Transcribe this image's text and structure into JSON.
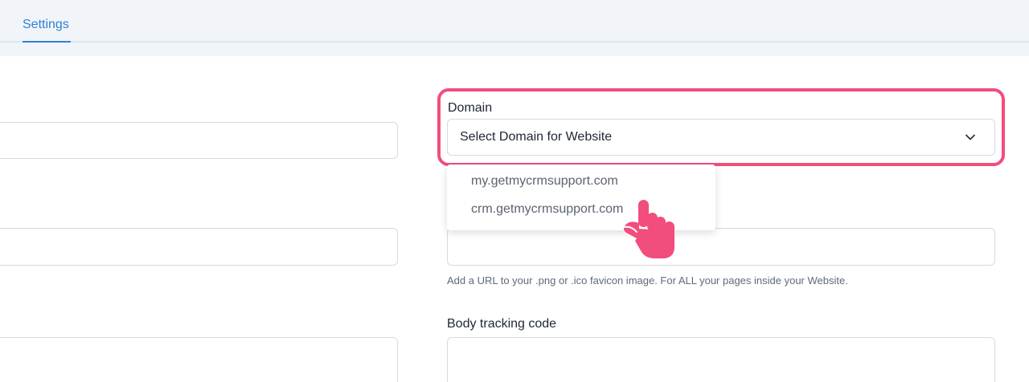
{
  "tabs": {
    "settings_label": "Settings"
  },
  "domain_field": {
    "label": "Domain",
    "selected_value": "Select Domain for Website",
    "options": [
      "my.getmycrmsupport.com",
      "crm.getmycrmsupport.com"
    ]
  },
  "favicon_field": {
    "help_text": "Add a URL to your .png or .ico favicon image. For ALL your pages inside your Website."
  },
  "body_tracking_field": {
    "label": "Body tracking code"
  },
  "colors": {
    "accent": "#2f80d7",
    "highlight": "#f14d7d",
    "pointer": "#f14d7d"
  },
  "icons": {
    "dropdown": "chevron-down-icon",
    "pointer": "hand-pointer-icon"
  }
}
